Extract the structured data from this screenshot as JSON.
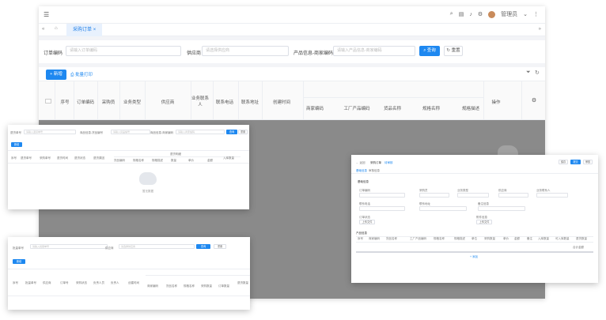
{
  "main": {
    "tab_label": "采购订单",
    "user_name": "管理员",
    "filters": {
      "order_no_label": "订单编码",
      "order_no_placeholder": "请输入订单编码",
      "supplier_label": "供应商",
      "supplier_placeholder": "请选择供应商",
      "product_label": "产品信息-商家编码",
      "product_placeholder": "请输入产品信息-商家编码",
      "search_label": "查询",
      "reset_label": "重置"
    },
    "toolbar": {
      "add_label": "新增",
      "batch_print_label": "批量打印"
    },
    "table": {
      "col_seq": "序号",
      "col_order_no": "订单编码",
      "col_buyer": "采购员",
      "col_biz_type": "业务类型",
      "col_supplier": "供应商",
      "col_contact": "业务联系人",
      "col_phone": "联系电话",
      "col_address": "联系地址",
      "col_created": "创建时间",
      "col_merchant_code": "商家编码",
      "col_factory_code": "工厂产品编码",
      "col_spec_name": "货品名称",
      "col_spec_name2": "规格名称",
      "col_spec_desc": "规格描述",
      "col_ops": "操作"
    }
  },
  "win_left_top": {
    "filter1_label": "退货单号",
    "filter1_placeholder": "请输入退货单号",
    "filter2_label": "商品信息-货品编号",
    "filter2_placeholder": "请输入货品编号",
    "filter3_label": "商品信息-商家编码",
    "filter3_placeholder": "请输入商家编码",
    "search_label": "查询",
    "reset_label": "重置",
    "add_label": "新增",
    "headers": [
      "序号",
      "退货单号",
      "采购单号",
      "退货时间",
      "退货状态",
      "退货原因",
      "规格名称",
      "入库数量"
    ],
    "sub_headers": [
      "货品编码",
      "规格名称",
      "规格描述",
      "数量",
      "单价",
      "金额"
    ],
    "group_header": "退货明细",
    "empty_text": "暂无数据"
  },
  "win_left_bottom": {
    "filter1_label": "批量单号",
    "filter1_placeholder": "请输入批量单号",
    "filter2_label": "供应商",
    "filter2_placeholder": "请选择供应商",
    "search_label": "查询",
    "reset_label": "重置",
    "add_label": "新增",
    "headers": [
      "序号",
      "批量单号",
      "供应商",
      "订单号",
      "采购状态",
      "负责人员",
      "负责人",
      "创建时间"
    ],
    "sub_headers": [
      "商家编码",
      "货品名称",
      "规格名称",
      "采购数量",
      "订单数量"
    ],
    "extra_header": "退货数量"
  },
  "win_right": {
    "back_label": "返回",
    "title": "采购订单",
    "status": "待审核",
    "top_buttons": [
      "保存",
      "提交",
      "审核"
    ],
    "tabs": [
      "基础信息",
      "审核信息"
    ],
    "section_basic": "基础信息",
    "fields_row1": [
      "订单编码",
      "采购员",
      "业务类型",
      "供应商",
      "业务联系人"
    ],
    "fields_row2": [
      "联系电话",
      "联系地址",
      "备注信息"
    ],
    "fields_row3": [
      "订单状态",
      "附件信息"
    ],
    "upload_label": "上传文件",
    "section_product": "产品信息",
    "product_headers": [
      "序号",
      "商家编码",
      "货品名称",
      "工厂产品编码",
      "规格名称",
      "规格描述",
      "单位",
      "采购数量",
      "单价",
      "金额",
      "备注",
      "入库数量",
      "可入库数量",
      "退货数量"
    ],
    "total_label": "合计金额",
    "add_row_label": "添加"
  }
}
